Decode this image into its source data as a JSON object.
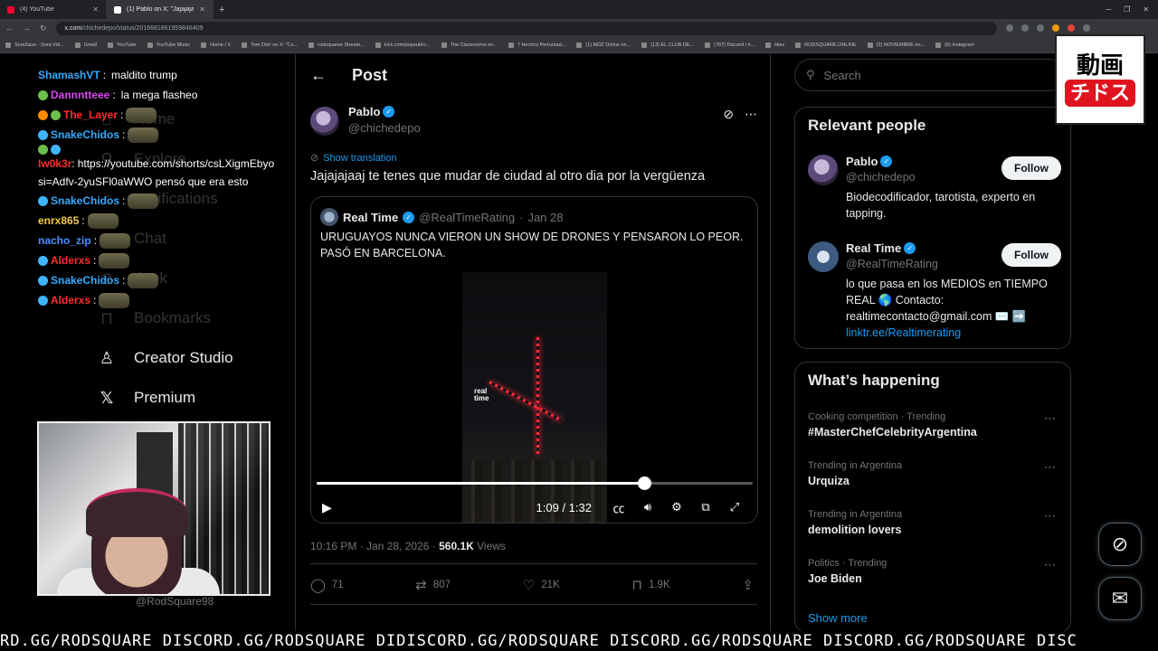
{
  "browser": {
    "tabs": [
      {
        "title": "(4) YouTube",
        "active": false
      },
      {
        "title": "(1) Pablo on X: \"Jajajajaaj te ten",
        "active": true
      }
    ],
    "url_host": "x.com",
    "url_path": "/chichedepo/status/2016681861959848409",
    "bookmarks": [
      "SoraSave - Sora Vid...",
      "Gmail",
      "YouTube",
      "YouTube Music",
      "Home / X",
      "Tom Dörr on X: \"Co...",
      "rodsquaree Stream...",
      "kick.com/popout/ro...",
      "The Classrooms en...",
      "7 Hechos Perturbad...",
      "(1) MDZ Online on...",
      "(13) EL CLUB DE...",
      "(787) Discord | #...",
      "likes",
      "RODSQUARE.ONLINE",
      "(2) NOVIEMBRE en...",
      "(6) Instagram"
    ]
  },
  "chat": [
    {
      "user": "ShamashVT",
      "msg": "maldito trump",
      "color": "cyan",
      "badges": []
    },
    {
      "user": "Dannntteee",
      "msg": "la mega flasheo",
      "color": "pink",
      "badges": [
        "green"
      ]
    },
    {
      "user": "The_Layer",
      "msg": "",
      "color": "red",
      "badges": [
        "orange",
        "green"
      ],
      "emote": true
    },
    {
      "user": "SnakeChidos",
      "msg": "",
      "color": "cyan",
      "badges": [
        "cyan"
      ],
      "emote": true
    },
    {
      "user": "",
      "msg": "",
      "color": "cyan",
      "badges": [
        "green",
        "cyan"
      ]
    },
    {
      "user": "Iw0k3r",
      "msg": "https://youtube.com/shorts/csLXigmEbyo si=Adfv-2yuSFl0aWWO pensó que era esto",
      "color": "red",
      "badges": [],
      "wrap": true
    },
    {
      "user": "SnakeChidos",
      "msg": "",
      "color": "cyan",
      "badges": [
        "cyan"
      ],
      "emote": true
    },
    {
      "user": "enrx865",
      "msg": "",
      "color": "yellow",
      "badges": [],
      "emote": true
    },
    {
      "user": "nacho_zip",
      "msg": "",
      "color": "blue",
      "badges": [],
      "emote": true
    },
    {
      "user": "Alderxs",
      "msg": "",
      "color": "red",
      "badges": [
        "cyan"
      ],
      "emote": true
    },
    {
      "user": "SnakeChidos",
      "msg": "",
      "color": "cyan",
      "badges": [
        "cyan"
      ],
      "emote": true
    },
    {
      "user": "Alderxs",
      "msg": "",
      "color": "red",
      "badges": [
        "cyan"
      ],
      "emote": true
    }
  ],
  "leftnav": {
    "items": [
      {
        "label": "Home",
        "ghost": true
      },
      {
        "label": "Explore",
        "ghost": true
      },
      {
        "label": "Notifications",
        "ghost": true
      },
      {
        "label": "Chat",
        "ghost": true
      },
      {
        "label": "Grok",
        "ghost": true
      },
      {
        "label": "Bookmarks",
        "ghost": true
      },
      {
        "label": "Creator Studio",
        "ghost": false
      },
      {
        "label": "Premium",
        "ghost": false
      }
    ],
    "account_handle": "@RodSquare98"
  },
  "post": {
    "header_title": "Post",
    "author_name": "Pablo",
    "author_handle": "@chichedepo",
    "show_translation": "Show translation",
    "text": "Jajajajaaj te tenes que mudar de ciudad al otro dia por la vergüenza",
    "quote": {
      "name": "Real Time",
      "handle": "@RealTimeRating",
      "date": "Jan 28",
      "text": "URUGUAYOS NUNCA VIERON UN SHOW DE DRONES Y PENSARON LO PEOR. PASÓ EN BARCELONA.",
      "video_logo_1": "real",
      "video_logo_2": "time",
      "time": "1:09 / 1:32",
      "progress": 0.75
    },
    "timestamp": "10:16 PM · Jan 28, 2026 · ",
    "views_count": "560.1K",
    "views_label": " Views",
    "actions": {
      "replies": "71",
      "reposts": "807",
      "likes": "21K",
      "bookmarks": "1.9K"
    }
  },
  "sidebar": {
    "search_placeholder": "Search",
    "relevant_title": "Relevant people",
    "people": [
      {
        "name": "Pablo",
        "handle": "@chichedepo",
        "bio": "Biodecodificador, tarotista, experto en tapping.",
        "follow": "Follow"
      },
      {
        "name": "Real Time",
        "handle": "@RealTimeRating",
        "bio": "lo que pasa en los MEDIOS en TIEMPO REAL 🌎 Contacto: realtimecontacto@gmail.com ✉️ ➡️",
        "link": "linktr.ee/Realtimerating",
        "follow": "Follow"
      }
    ],
    "happening_title": "What’s happening",
    "trends": [
      {
        "category": "Cooking competition · Trending",
        "name": "#MasterChefCelebrityArgentina"
      },
      {
        "category": "Trending in Argentina",
        "name": "Urquiza"
      },
      {
        "category": "Trending in Argentina",
        "name": "demolition lovers"
      },
      {
        "category": "Politics · Trending",
        "name": "Joe Biden"
      }
    ],
    "show_more": "Show more"
  },
  "overlay": {
    "logo_top": "動画",
    "logo_bottom": "チドス",
    "ticker": "RD.GG/RODSQUARE DISCORD.GG/RODSQUARE DIDISCORD.GG/RODSQUARE DISCORD.GG/RODSQUARE DISCORD.GG/RODSQUARE DISC"
  },
  "icons": {
    "back": "arrow-left-icon",
    "grok": "grok-icon",
    "more": "more-dots-icon",
    "reply": "reply-icon",
    "repost": "repost-icon",
    "like": "heart-icon",
    "bookmark": "bookmark-icon",
    "share": "share-icon",
    "messages": "envelope-icon"
  },
  "colors": {
    "accent": "#1d9bf0",
    "verified": "#1d9bf0",
    "video_drone": "#ff2a3a"
  }
}
